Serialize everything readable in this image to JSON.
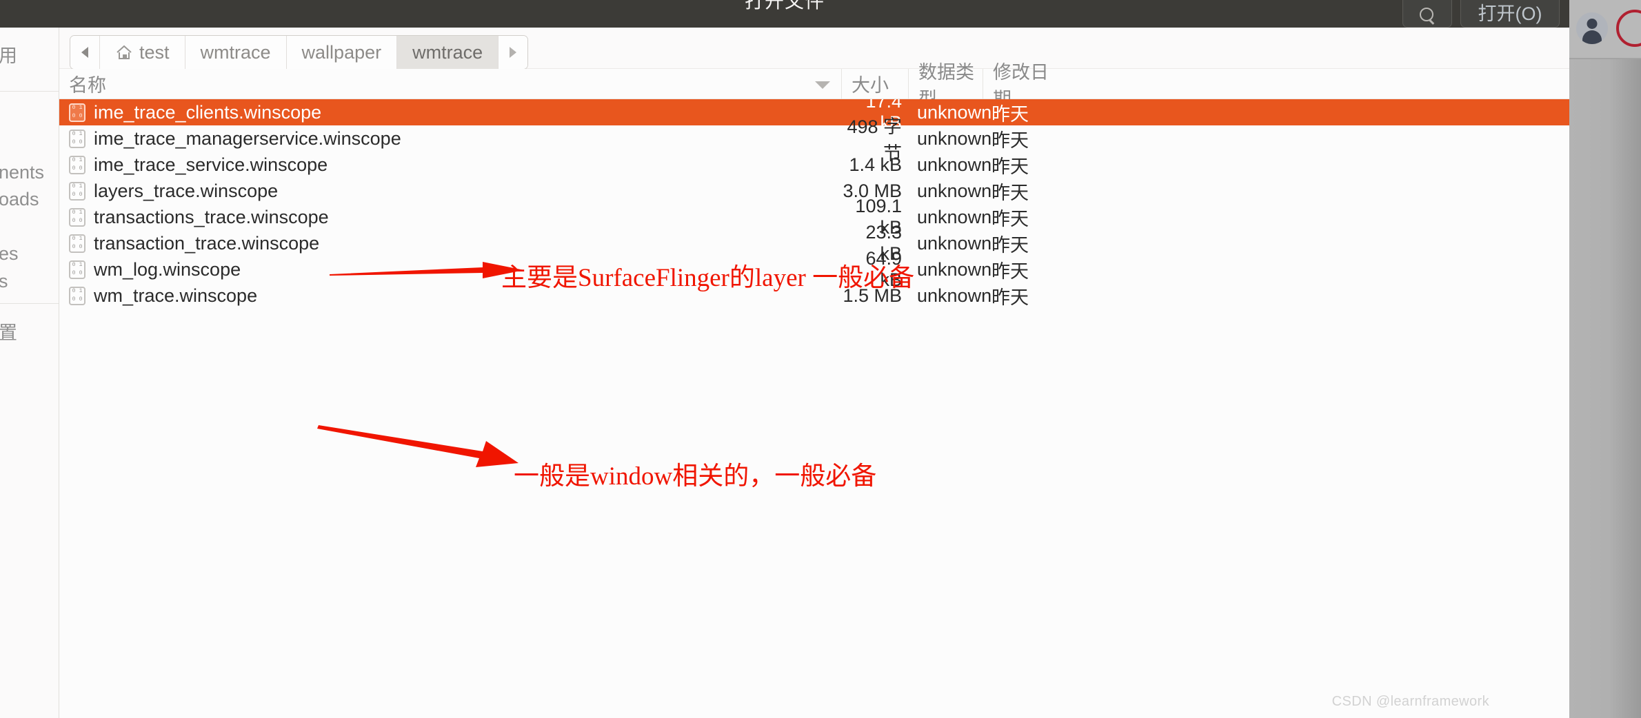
{
  "window": {
    "title": "打开文件",
    "search_button_icon": "search-icon",
    "open_button_label": "打开(O)"
  },
  "sidebar": {
    "items": [
      {
        "label": "用",
        "clipped_from": "最近使用"
      },
      {
        "label": "nents",
        "clipped_from": "Documents"
      },
      {
        "label": "oads",
        "clipped_from": "Downloads"
      },
      {
        "label": "es",
        "clipped_from": "Pictures"
      },
      {
        "label": "s",
        "clipped_from": "Videos"
      },
      {
        "label": "置",
        "clipped_from": "其他位置"
      }
    ]
  },
  "pathbar": {
    "back_icon": "chevron-left-icon",
    "forward_icon": "chevron-right-icon",
    "crumbs": [
      {
        "label": "test",
        "icon": "home-icon",
        "active": false
      },
      {
        "label": "wmtrace",
        "icon": "",
        "active": false
      },
      {
        "label": "wallpaper",
        "icon": "",
        "active": false
      },
      {
        "label": "wmtrace",
        "icon": "",
        "active": true
      }
    ]
  },
  "columns": {
    "name": "名称",
    "size": "大小",
    "type": "数据类型",
    "date": "修改日期",
    "sort_icon": "sort-descending-triangle-icon"
  },
  "files": [
    {
      "name": "ime_trace_clients.winscope",
      "size": "17.4 kB",
      "type": "unknown",
      "date": "昨天",
      "selected": true
    },
    {
      "name": "ime_trace_managerservice.winscope",
      "size": "498 字节",
      "type": "unknown",
      "date": "昨天",
      "selected": false
    },
    {
      "name": "ime_trace_service.winscope",
      "size": "1.4 kB",
      "type": "unknown",
      "date": "昨天",
      "selected": false
    },
    {
      "name": "layers_trace.winscope",
      "size": "3.0 MB",
      "type": "unknown",
      "date": "昨天",
      "selected": false
    },
    {
      "name": "transactions_trace.winscope",
      "size": "109.1 kB",
      "type": "unknown",
      "date": "昨天",
      "selected": false
    },
    {
      "name": "transaction_trace.winscope",
      "size": "23.3 kB",
      "type": "unknown",
      "date": "昨天",
      "selected": false
    },
    {
      "name": "wm_log.winscope",
      "size": "64.9 kB",
      "type": "unknown",
      "date": "昨天",
      "selected": false
    },
    {
      "name": "wm_trace.winscope",
      "size": "1.5 MB",
      "type": "unknown",
      "date": "昨天",
      "selected": false
    }
  ],
  "annotations": [
    {
      "text": "主要是SurfaceFlinger的layer 一般必备",
      "target": "layers_trace.winscope"
    },
    {
      "text": "一般是window相关的，一般必备",
      "target": "wm_trace.winscope"
    }
  ],
  "watermark": "CSDN @learnframework",
  "colors": {
    "selection": "#e8561e",
    "annotation": "#f01500",
    "titlebar": "#3c3b37"
  }
}
